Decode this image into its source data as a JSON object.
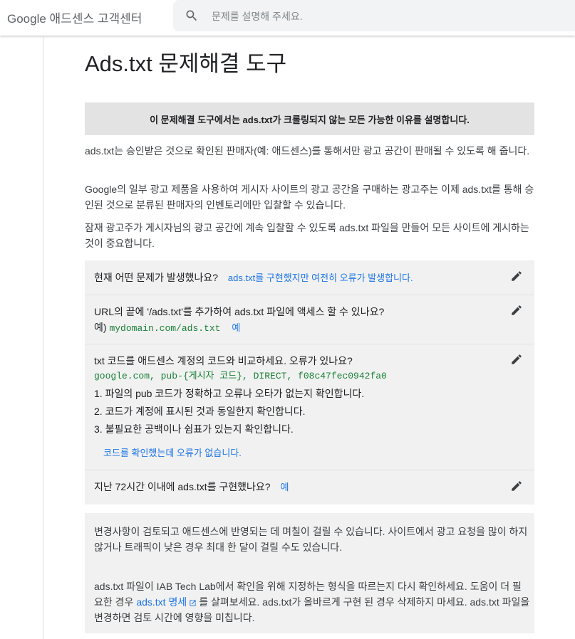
{
  "header": {
    "logo": "Google 애드센스 고객센터",
    "search_placeholder": "문제를 설명해 주세요."
  },
  "page": {
    "title": "Ads.txt 문제해결 도구",
    "notice": "이 문제해결 도구에서는 ads.txt가 크롤링되지 않는 모든 가능한 이유를 설명합니다.",
    "paragraphs": [
      "ads.txt는 승인받은 것으로 확인된 판매자(예: 애드센스)를 통해서만 광고 공간이 판매될 수 있도록 해 줍니다.",
      "Google의 일부 광고 제품을 사용하여 게시자 사이트의 광고 공간을 구매하는 광고주는 이제 ads.txt를 통해 승인된 것으로 분류된 판매자의 인벤토리에만 입찰할 수 있습니다.",
      "잠재 광고주가 게시자님의 광고 공간에 계속 입찰할 수 있도록 ads.txt 파일을 만들어 모든 사이트에 게시하는 것이 중요합니다."
    ]
  },
  "steps": {
    "q1": {
      "question": "현재 어떤 문제가 발생했나요?",
      "answer": "ads.txt를 구현했지만 여전히 오류가 발생합니다."
    },
    "q2": {
      "question": "URL의 끝에 '/ads.txt'를 추가하여 ads.txt 파일에 액세스 할 수 있나요?",
      "example_prefix": "예)",
      "example_code": "mydomain.com/ads.txt",
      "answer": "예"
    },
    "q3": {
      "question": "txt 코드를 애드센스 계정의 코드와 비교하세요. 오류가 있나요?",
      "code": "google.com, pub-{게시자 코드}, DIRECT, f08c47fec0942fa0",
      "items": [
        "1. 파일의 pub 코드가 정확하고 오류나 오타가 없는지 확인합니다.",
        "2. 코드가 계정에 표시된 것과 동일한지 확인합니다.",
        "3. 불필요한 공백이나 쉼표가 있는지 확인합니다."
      ],
      "answer": "코드를 확인했는데 오류가 없습니다."
    },
    "q4": {
      "question": "지난 72시간 이내에 ads.txt를 구현했나요?",
      "answer": "예"
    }
  },
  "info": {
    "p1": "변경사항이 검토되고 애드센스에 반영되는 데 며칠이 걸릴 수 있습니다. 사이트에서 광고 요청을 많이 하지 않거나 트래픽이 낮은 경우 최대 한 달이 걸릴 수도 있습니다.",
    "p2_before": "ads.txt 파일이 IAB Tech Lab에서 확인을 위해 지정하는 형식을 따르는지 다시 확인하세요. 도움이 더 필요한 경우",
    "p2_link": "ads.txt 명세",
    "p2_after": "를 살펴보세요. ads.txt가 올바르게 구현 된 경우 삭제하지 마세요. ads.txt 파일을 변경하면 검토 시간에 영향을 미칩니다."
  },
  "icons": {
    "search": "search-icon",
    "edit": "pencil-edit-icon",
    "external": "open-in-new-icon"
  },
  "colors": {
    "link": "#1a73e8",
    "code": "#188038",
    "panel": "#f1f1f1",
    "notice": "#e3e3e3"
  }
}
